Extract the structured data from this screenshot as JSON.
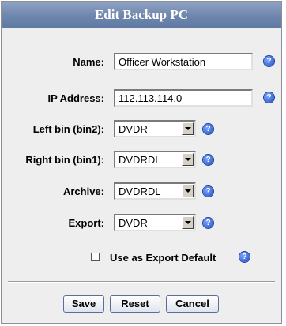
{
  "dialog": {
    "title": "Edit Backup PC",
    "fields": {
      "name": {
        "label": "Name:",
        "value": "Officer Workstation"
      },
      "ip": {
        "label": "IP Address:",
        "value": "112.113.114.0"
      },
      "left_bin": {
        "label": "Left bin (bin2):",
        "selected": "DVDR"
      },
      "right_bin": {
        "label": "Right bin (bin1):",
        "selected": "DVDRDL"
      },
      "archive": {
        "label": "Archive:",
        "selected": "DVDRDL"
      },
      "export": {
        "label": "Export:",
        "selected": "DVDR"
      }
    },
    "export_default": {
      "label": "Use as Export Default",
      "checked": false
    },
    "help_glyph": "?",
    "buttons": {
      "save": "Save",
      "reset": "Reset",
      "cancel": "Cancel"
    }
  },
  "icons": [
    "help-icon",
    "dropdown-arrow-icon"
  ],
  "colors": {
    "title_bar": "#6f86ad",
    "help_icon": "#1f4fc4",
    "dialog_bg": "#eeeeee"
  }
}
